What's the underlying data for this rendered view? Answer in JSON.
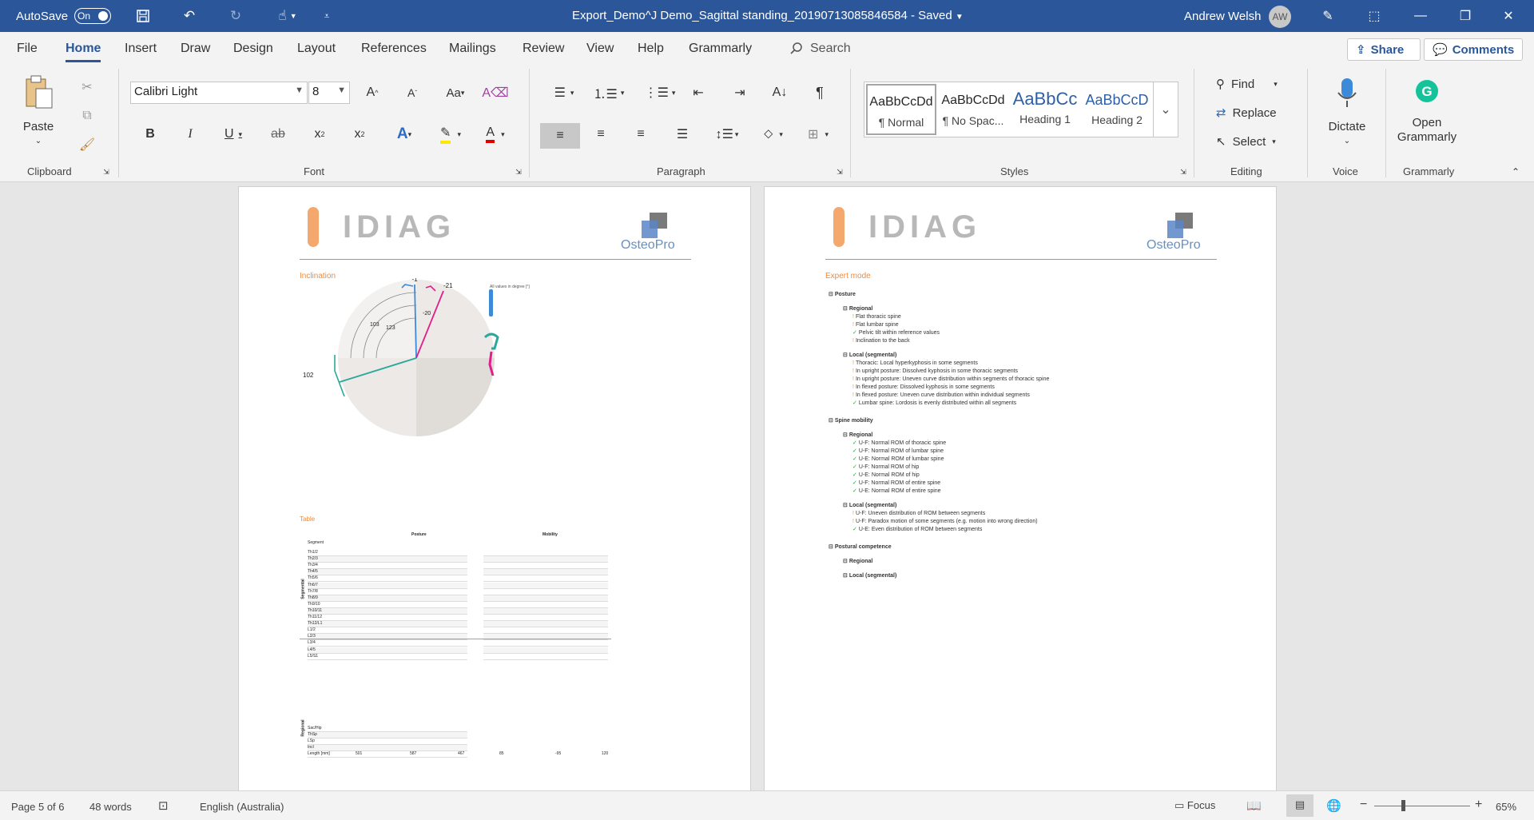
{
  "titlebar": {
    "autosave_label": "AutoSave",
    "autosave_state": "On",
    "doc_title": "Export_Demo^J Demo_Sagittal standing_20190713085846584  -  Saved",
    "user_name": "Andrew Welsh",
    "user_initials": "AW"
  },
  "tabs": [
    "File",
    "Home",
    "Insert",
    "Draw",
    "Design",
    "Layout",
    "References",
    "Mailings",
    "Review",
    "View",
    "Help",
    "Grammarly"
  ],
  "search_label": "Search",
  "share_label": "Share",
  "comments_label": "Comments",
  "ribbon": {
    "clipboard": {
      "paste": "Paste",
      "label": "Clipboard"
    },
    "font": {
      "family": "Calibri Light",
      "size": "8",
      "label": "Font"
    },
    "paragraph": {
      "label": "Paragraph"
    },
    "styles": {
      "label": "Styles",
      "items": [
        {
          "preview": "AaBbCcDd",
          "name": "¶ Normal"
        },
        {
          "preview": "AaBbCcDd",
          "name": "¶ No Spac..."
        },
        {
          "preview": "AaBbCc",
          "name": "Heading 1"
        },
        {
          "preview": "AaBbCcD",
          "name": "Heading 2"
        }
      ]
    },
    "editing": {
      "find": "Find",
      "replace": "Replace",
      "select": "Select",
      "label": "Editing"
    },
    "voice": {
      "dictate": "Dictate",
      "label": "Voice"
    },
    "grammarly": {
      "open": "Open Grammarly",
      "label": "Grammarly"
    }
  },
  "page1": {
    "brand": "IDIAG",
    "osteo": "OsteoPro",
    "inclination_title": "Inclination",
    "all_values_note": "All values in degree [°]",
    "labels": {
      "a": "-1",
      "b": "-21",
      "c": "-20",
      "d": "103",
      "e": "123",
      "f": "102"
    },
    "table_title": "Table",
    "posture_head": "Posture",
    "mobility_head": "Mobility",
    "segment_head": "Segment",
    "segmental_label": "Segmental",
    "regional_label": "Regional",
    "segments": [
      "Th1/2",
      "Th2/3",
      "Th3/4",
      "Th4/5",
      "Th5/6",
      "Th6/7",
      "Th7/8",
      "Th8/9",
      "Th9/10",
      "Th10/11",
      "Th11/12",
      "Th12/L1",
      "L1/2",
      "L2/3",
      "L3/4",
      "L4/5",
      "L5/S1"
    ],
    "regional_rows": [
      "Sac/Hip",
      "ThSp",
      "LSp",
      "Incl",
      "Length [mm]"
    ],
    "lengths": [
      "501",
      "587",
      "467",
      "85",
      "-95",
      "120"
    ]
  },
  "page2": {
    "brand": "IDIAG",
    "osteo": "OsteoPro",
    "expert_title": "Expert mode",
    "posture": "Posture",
    "regional": "Regional",
    "posture_regional": [
      {
        "t": "Flat thoracic spine",
        "s": "warn"
      },
      {
        "t": "Flat lumbar spine",
        "s": "warn"
      },
      {
        "t": "Pelvic tilt within reference values",
        "s": "ok"
      },
      {
        "t": "Inclination to the back",
        "s": "warn"
      }
    ],
    "local": "Local (segmental)",
    "posture_local": [
      {
        "t": "Thoracic: Local hyperkyphosis in some segments",
        "s": "warn"
      },
      {
        "t": "In upright posture: Dissolved kyphosis in some thoracic segments",
        "s": "warn"
      },
      {
        "t": "In upright posture: Uneven curve distribution within segments of thoracic spine",
        "s": "warn"
      },
      {
        "t": "In flexed posture: Dissolved kyphosis in some segments",
        "s": "warn"
      },
      {
        "t": "In flexed posture: Uneven curve distribution within individual segments",
        "s": "warn"
      },
      {
        "t": "Lumbar spine: Lordosis is evenly distributed within all segments",
        "s": "ok"
      }
    ],
    "mobility": "Spine mobility",
    "mobility_regional": [
      {
        "t": "U-F: Normal ROM of thoracic spine",
        "s": "ok"
      },
      {
        "t": "U-F: Normal ROM of lumbar spine",
        "s": "ok"
      },
      {
        "t": "U-E: Normal ROM of lumbar spine",
        "s": "ok"
      },
      {
        "t": "U-F: Normal ROM of hip",
        "s": "ok"
      },
      {
        "t": "U-E: Normal ROM of hip",
        "s": "ok"
      },
      {
        "t": "U-F: Normal ROM of entire spine",
        "s": "ok"
      },
      {
        "t": "U-E: Normal ROM of entire spine",
        "s": "ok"
      }
    ],
    "mobility_local": [
      {
        "t": "U-F: Uneven distribution of ROM between segments",
        "s": "warn"
      },
      {
        "t": "U-F: Paradox motion of some segments (e.g. motion into wrong direction)",
        "s": "warn"
      },
      {
        "t": "U-E: Even distribution of ROM between segments",
        "s": "ok"
      }
    ],
    "competence": "Postural competence",
    "competence_regional": "Regional",
    "competence_local": "Local (segmental)"
  },
  "statusbar": {
    "page": "Page 5 of 6",
    "words": "48 words",
    "language": "English (Australia)",
    "focus": "Focus",
    "zoom": "65%"
  }
}
